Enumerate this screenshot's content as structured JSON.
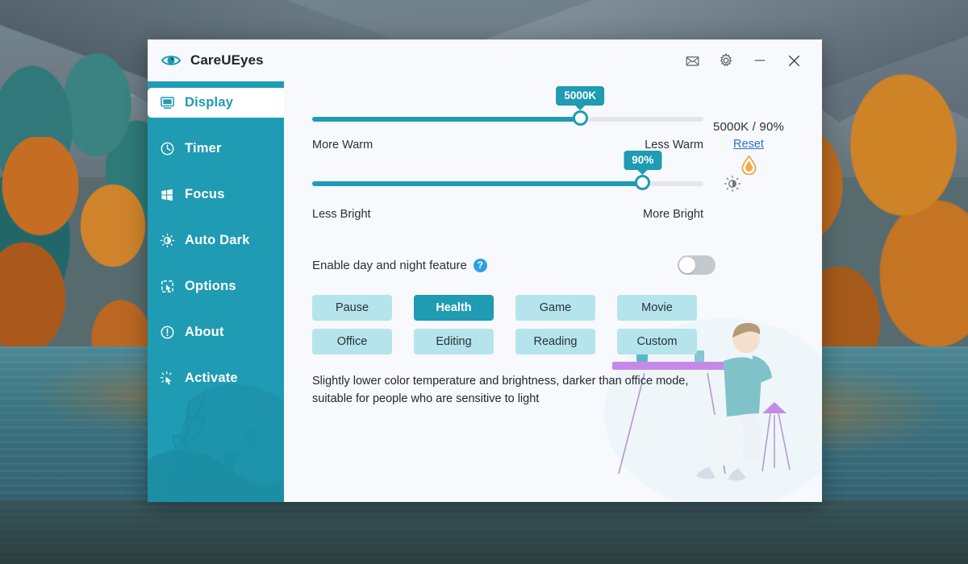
{
  "window": {
    "title": "CareUEyes",
    "logo_icon": "eye-icon",
    "titlebar_buttons": [
      {
        "name": "mail-icon",
        "label": "Feedback"
      },
      {
        "name": "gear-icon",
        "label": "Settings"
      },
      {
        "name": "minimize-icon",
        "label": "Minimize"
      },
      {
        "name": "close-icon",
        "label": "Close"
      }
    ]
  },
  "sidebar": {
    "accent_color": "#1f9bb3",
    "items": [
      {
        "label": "Display",
        "icon": "monitor-icon",
        "active": true
      },
      {
        "label": "Timer",
        "icon": "clock-icon",
        "active": false
      },
      {
        "label": "Focus",
        "icon": "windows-icon",
        "active": false
      },
      {
        "label": "Auto Dark",
        "icon": "sun-dark-icon",
        "active": false
      },
      {
        "label": "Options",
        "icon": "cursor-box-icon",
        "active": false
      },
      {
        "label": "About",
        "icon": "info-icon",
        "active": false
      },
      {
        "label": "Activate",
        "icon": "click-icon",
        "active": false
      }
    ]
  },
  "status": {
    "value_text": "5000K / 90%",
    "reset_label": "Reset",
    "droplet_icon": "droplet-icon",
    "droplet_color": "#f0a33c",
    "link_color": "#2f6fd0"
  },
  "temperature_slider": {
    "name": "color-temperature-slider",
    "bubble_value": "5000K",
    "percent": 68.5,
    "left_caption": "More Warm",
    "right_caption": "Less Warm",
    "side_icon": "droplet-icon"
  },
  "brightness_slider": {
    "name": "brightness-slider",
    "bubble_value": "90%",
    "percent": 84.5,
    "left_caption": "Less Bright",
    "right_caption": "More Bright",
    "side_icon": "brightness-icon"
  },
  "day_night": {
    "label": "Enable day and night feature",
    "help_icon": "help-circle-icon",
    "toggle_state": "off"
  },
  "modes": {
    "buttons": [
      {
        "label": "Pause",
        "active": false
      },
      {
        "label": "Health",
        "active": true
      },
      {
        "label": "Game",
        "active": false
      },
      {
        "label": "Movie",
        "active": false
      },
      {
        "label": "Office",
        "active": false
      },
      {
        "label": "Editing",
        "active": false
      },
      {
        "label": "Reading",
        "active": false
      },
      {
        "label": "Custom",
        "active": false
      }
    ],
    "description": "Slightly lower color temperature and brightness, darker than office mode, suitable for people who are sensitive to light"
  }
}
